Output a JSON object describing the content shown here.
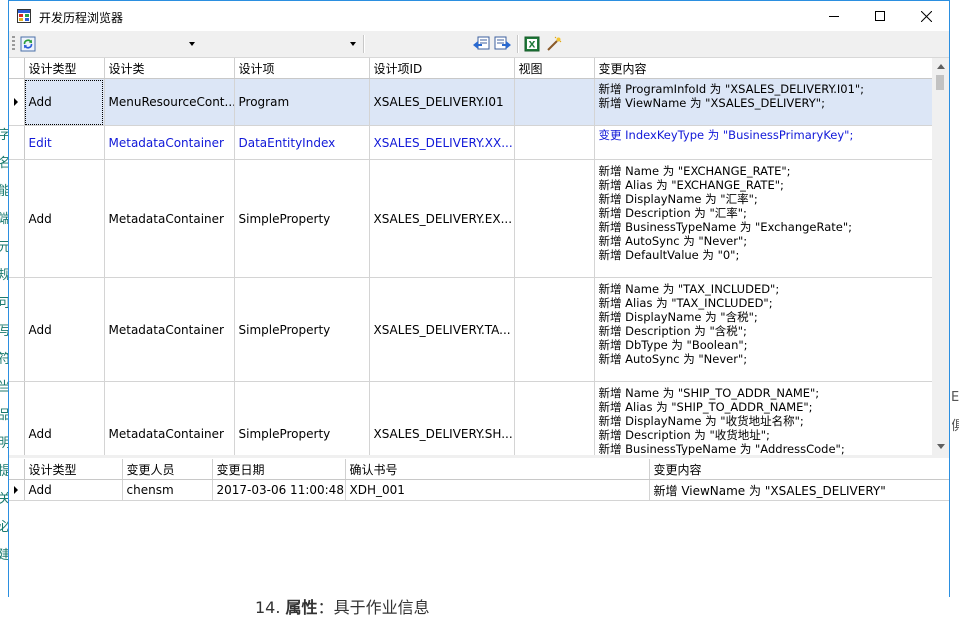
{
  "window": {
    "title": "开发历程浏览器",
    "icon": "grid-app-icon",
    "controls": [
      "minimize-icon",
      "maximize-icon",
      "close-icon"
    ]
  },
  "toolbar": {
    "refresh_icon": "refresh-icon",
    "combo1_value": "",
    "combo2_value": "",
    "text_value": "",
    "icons": [
      "navigate-back-icon",
      "navigate-forward-icon",
      "excel-export-icon",
      "edit-wand-icon"
    ]
  },
  "top_grid": {
    "columns": [
      "设计类型",
      "设计类",
      "设计项",
      "设计项ID",
      "视图",
      "变更内容"
    ],
    "rows": [
      {
        "type": "Add",
        "cls": "MenuResourceCont...",
        "item": "Program",
        "id": "XSALES_DELIVERY.I01",
        "view": "",
        "change": "新增 ProgramInfoId 为 \"XSALES_DELIVERY.I01\";\n新增 ViewName 为 \"XSALES_DELIVERY\";"
      },
      {
        "type": "Edit",
        "cls": "MetadataContainer",
        "item": "DataEntityIndex",
        "id": "XSALES_DELIVERY.XX...",
        "view": "",
        "change": "变更 IndexKeyType 为 \"BusinessPrimaryKey\";"
      },
      {
        "type": "Add",
        "cls": "MetadataContainer",
        "item": "SimpleProperty",
        "id": "XSALES_DELIVERY.EX...",
        "view": "",
        "change": "新增 Name 为 \"EXCHANGE_RATE\";\n新增 Alias 为 \"EXCHANGE_RATE\";\n新增 DisplayName 为 \"汇率\";\n新增 Description 为 \"汇率\";\n新增 BusinessTypeName 为 \"ExchangeRate\";\n新增 AutoSync 为 \"Never\";\n新增 DefaultValue 为 \"0\";"
      },
      {
        "type": "Add",
        "cls": "MetadataContainer",
        "item": "SimpleProperty",
        "id": "XSALES_DELIVERY.TA...",
        "view": "",
        "change": "新增 Name 为 \"TAX_INCLUDED\";\n新增 Alias 为 \"TAX_INCLUDED\";\n新增 DisplayName 为 \"含税\";\n新增 Description 为 \"含税\";\n新增 DbType 为 \"Boolean\";\n新增 AutoSync 为 \"Never\";"
      },
      {
        "type": "Add",
        "cls": "MetadataContainer",
        "item": "SimpleProperty",
        "id": "XSALES_DELIVERY.SH...",
        "view": "",
        "change": "新增 Name 为 \"SHIP_TO_ADDR_NAME\";\n新增 Alias 为 \"SHIP_TO_ADDR_NAME\";\n新增 DisplayName 为 \"收货地址名称\";\n新增 Description 为 \"收货地址\";\n新增 BusinessTypeName 为 \"AddressCode\";"
      }
    ]
  },
  "bottom_grid": {
    "columns": [
      "设计类型",
      "变更人员",
      "变更日期",
      "确认书号",
      "变更内容"
    ],
    "rows": [
      {
        "type": "Add",
        "user": "chensm",
        "date": "2017-03-06 11:00:48",
        "doc": "XDH_001",
        "change": "新增 ViewName 为 \"XSALES_DELIVERY\""
      }
    ]
  },
  "background": {
    "left_glyphs": [
      "字",
      "名",
      "能",
      "端",
      "元",
      "规",
      "可",
      "写",
      "符",
      "当",
      "品",
      "明",
      "提",
      "关",
      "必",
      "建"
    ],
    "right_glyphs": [
      "E",
      "俱"
    ],
    "bottom_text_num": "14.",
    "bottom_text_bold": "属性",
    "bottom_text_rest": "：具于作业信息"
  },
  "colors": {
    "selection": "#dce6f6",
    "edit_row_text": "#1018d8",
    "window_border": "#2b8fe0"
  }
}
